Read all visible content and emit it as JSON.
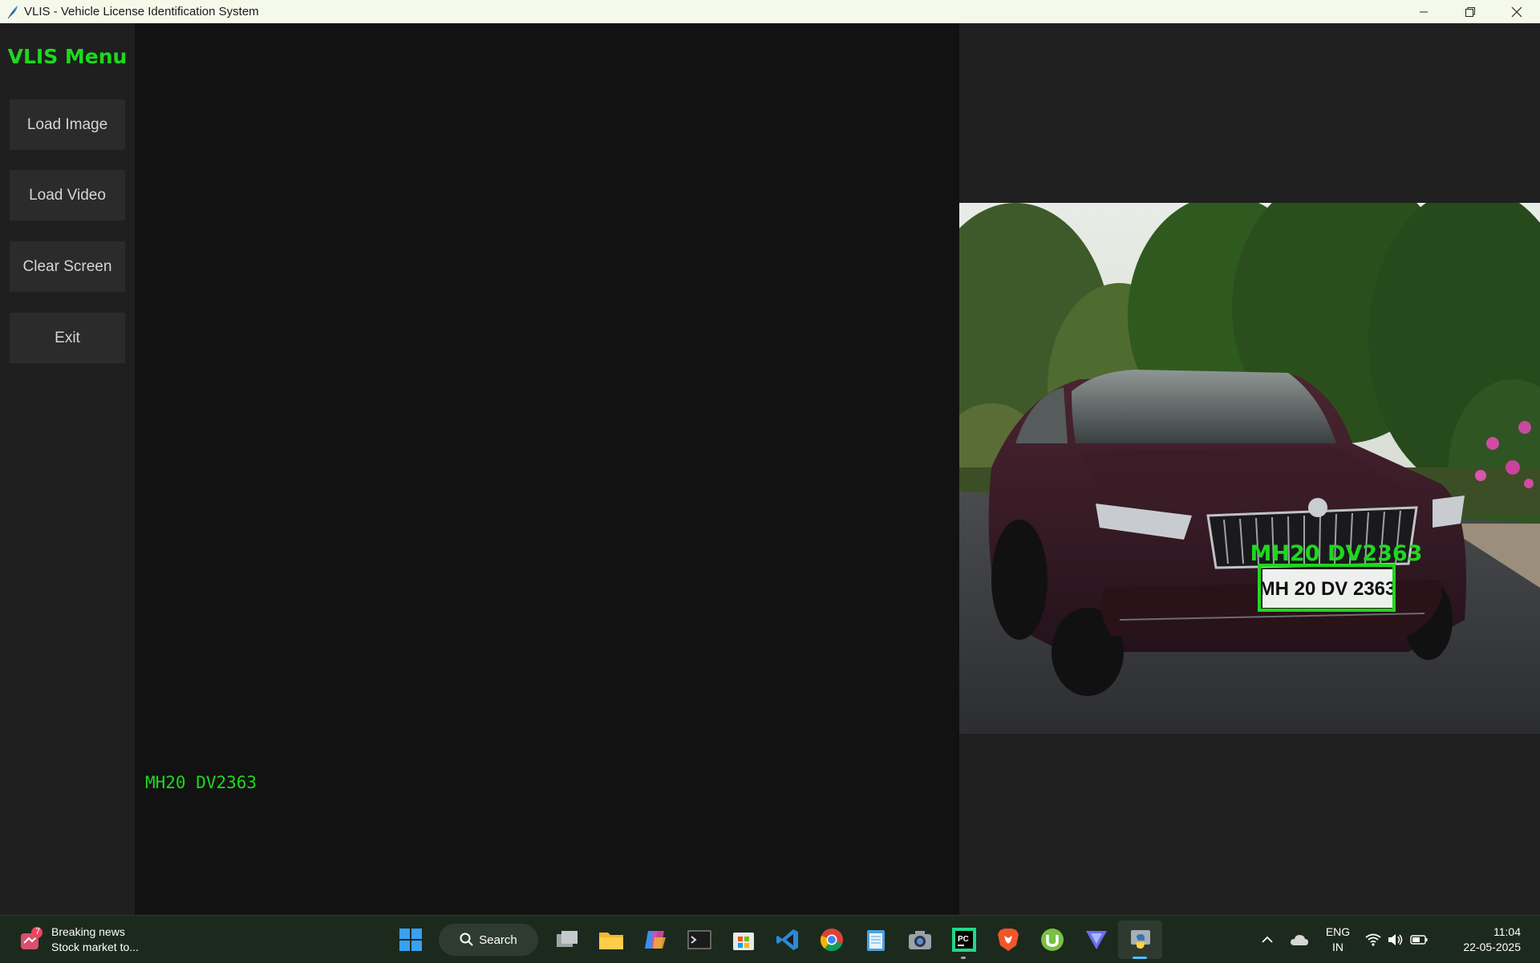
{
  "window": {
    "title": "VLIS - Vehicle License Identification System"
  },
  "sidebar": {
    "title": "VLIS Menu",
    "buttons": [
      {
        "label": "Load Image"
      },
      {
        "label": "Load Video"
      },
      {
        "label": "Clear Screen"
      },
      {
        "label": "Exit"
      }
    ]
  },
  "center": {
    "detected_plate": "MH20 DV2363"
  },
  "preview": {
    "overlay_text": "MH20 DV2363",
    "plate_text": "MH 20 DV 2363"
  },
  "taskbar": {
    "news_badge": "7",
    "news_title": "Breaking news",
    "news_subtitle": "Stock market to...",
    "search_label": "Search",
    "language_line1": "ENG",
    "language_line2": "IN",
    "time": "11:04",
    "date": "22-05-2025",
    "pycharm_label": "PC"
  },
  "colors": {
    "accent_green": "#1ed81e",
    "sidebar_bg": "#1f1f1f",
    "panel_bg": "#121212",
    "button_bg": "#2b2b2b"
  }
}
